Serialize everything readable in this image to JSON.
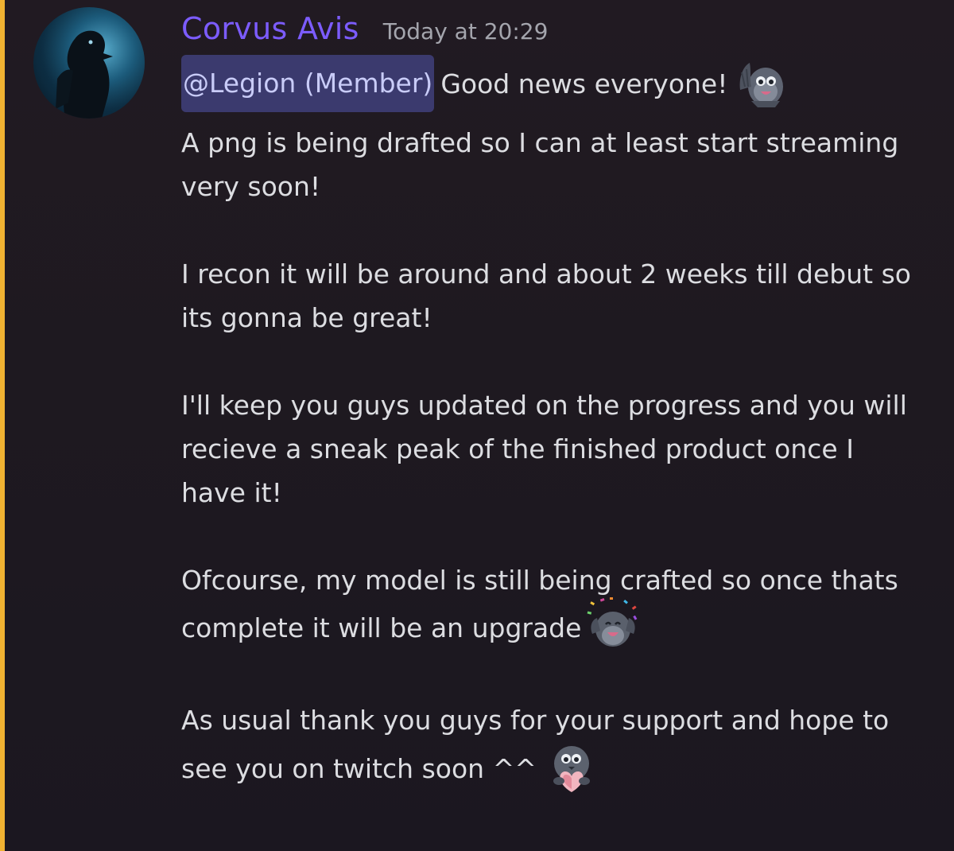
{
  "message": {
    "author": "Corvus Avis",
    "timestamp": "Today at 20:29",
    "mention": "@Legion (Member)",
    "first_line_text": "Good news everyone!",
    "lines": [
      "A png is being drafted so I can at least start streaming",
      "very soon!",
      "I recon it will be around and about 2 weeks till debut so",
      "its gonna be great!",
      "I'll keep you guys updated on the progress and you will",
      "recieve a sneak peak of the finished product once I",
      "have it!",
      "Ofcourse, my model is still being crafted so once thats",
      "complete it will be an upgrade",
      "As usual thank you guys for your support and hope to",
      "see you on twitch soon ^^"
    ],
    "emojis": [
      "raven-wave-emoji-icon",
      "raven-party-emoji-icon",
      "raven-heart-emoji-icon"
    ]
  },
  "colors": {
    "username": "#7c5cff",
    "mention_bg": "#3b3a6e",
    "highlight_bar": "#f0b232",
    "text": "#dcdde1",
    "timestamp": "#a4a5ad"
  }
}
